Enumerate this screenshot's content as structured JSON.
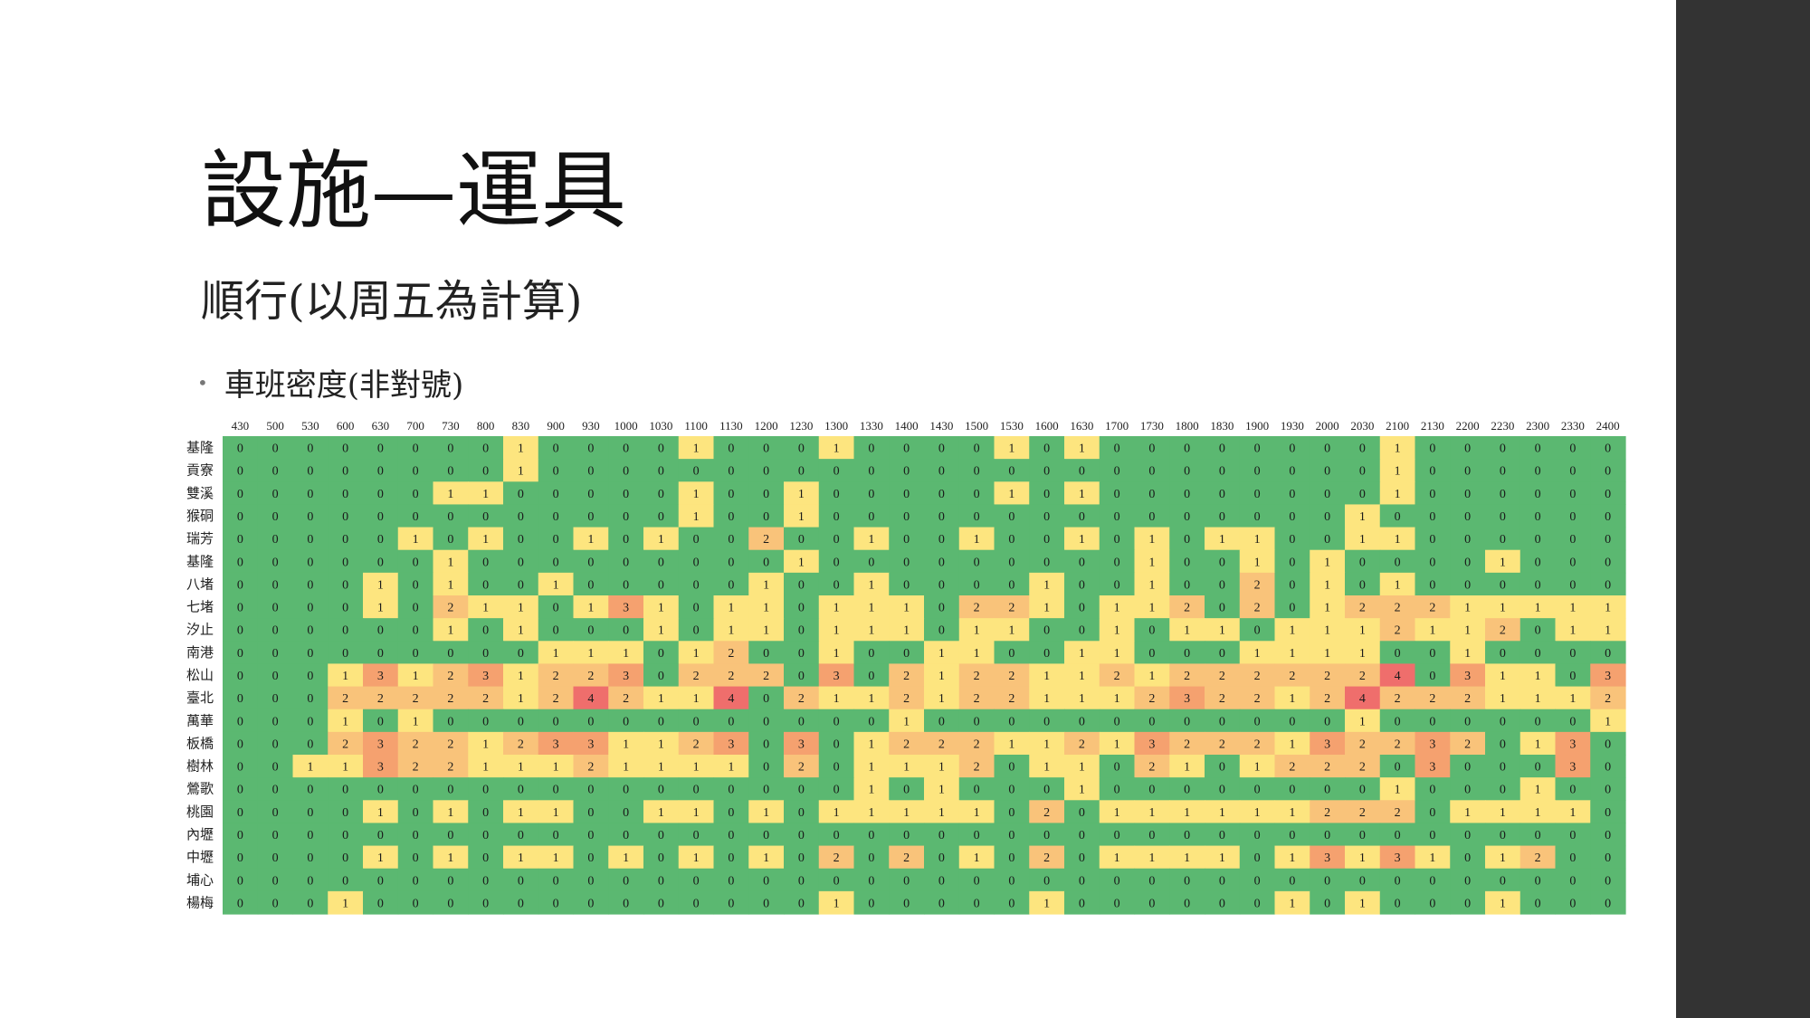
{
  "slide": {
    "title": "設施—運具",
    "subtitle": "順行(以周五為計算)",
    "bullet": "車班密度(非對號)"
  },
  "colors": {
    "sidebar": "#333333",
    "scale": [
      "#5bb871",
      "#fde57f",
      "#f9c37a",
      "#f5a16f",
      "#ef6e6c"
    ]
  },
  "chart_data": {
    "type": "heatmap",
    "x": [
      "430",
      "500",
      "530",
      "600",
      "630",
      "700",
      "730",
      "800",
      "830",
      "900",
      "930",
      "1000",
      "1030",
      "1100",
      "1130",
      "1200",
      "1230",
      "1300",
      "1330",
      "1400",
      "1430",
      "1500",
      "1530",
      "1600",
      "1630",
      "1700",
      "1730",
      "1800",
      "1830",
      "1900",
      "1930",
      "2000",
      "2030",
      "2100",
      "2130",
      "2200",
      "2230",
      "2300",
      "2330",
      "2400"
    ],
    "y": [
      "基隆",
      "貢寮",
      "雙溪",
      "猴硐",
      "瑞芳",
      "基隆",
      "八堵",
      "七堵",
      "汐止",
      "南港",
      "松山",
      "臺北",
      "萬華",
      "板橋",
      "樹林",
      "鶯歌",
      "桃園",
      "內壢",
      "中壢",
      "埔心",
      "楊梅"
    ],
    "values": [
      [
        0,
        0,
        0,
        0,
        0,
        0,
        0,
        0,
        1,
        0,
        0,
        0,
        0,
        1,
        0,
        0,
        0,
        1,
        0,
        0,
        0,
        0,
        1,
        0,
        1,
        0,
        0,
        0,
        0,
        0,
        0,
        0,
        0,
        1,
        0,
        0,
        0,
        0,
        0,
        0
      ],
      [
        0,
        0,
        0,
        0,
        0,
        0,
        0,
        0,
        1,
        0,
        0,
        0,
        0,
        0,
        0,
        0,
        0,
        0,
        0,
        0,
        0,
        0,
        0,
        0,
        0,
        0,
        0,
        0,
        0,
        0,
        0,
        0,
        0,
        1,
        0,
        0,
        0,
        0,
        0,
        0
      ],
      [
        0,
        0,
        0,
        0,
        0,
        0,
        1,
        1,
        0,
        0,
        0,
        0,
        0,
        1,
        0,
        0,
        1,
        0,
        0,
        0,
        0,
        0,
        1,
        0,
        1,
        0,
        0,
        0,
        0,
        0,
        0,
        0,
        0,
        1,
        0,
        0,
        0,
        0,
        0,
        0
      ],
      [
        0,
        0,
        0,
        0,
        0,
        0,
        0,
        0,
        0,
        0,
        0,
        0,
        0,
        1,
        0,
        0,
        1,
        0,
        0,
        0,
        0,
        0,
        0,
        0,
        0,
        0,
        0,
        0,
        0,
        0,
        0,
        0,
        1,
        0,
        0,
        0,
        0,
        0,
        0,
        0
      ],
      [
        0,
        0,
        0,
        0,
        0,
        1,
        0,
        1,
        0,
        0,
        1,
        0,
        1,
        0,
        0,
        2,
        0,
        0,
        1,
        0,
        0,
        1,
        0,
        0,
        1,
        0,
        1,
        0,
        1,
        1,
        0,
        0,
        1,
        1,
        0,
        0,
        0,
        0,
        0,
        0
      ],
      [
        0,
        0,
        0,
        0,
        0,
        0,
        1,
        0,
        0,
        0,
        0,
        0,
        0,
        0,
        0,
        0,
        1,
        0,
        0,
        0,
        0,
        0,
        0,
        0,
        0,
        0,
        1,
        0,
        0,
        1,
        0,
        1,
        0,
        0,
        0,
        0,
        1,
        0,
        0,
        0
      ],
      [
        0,
        0,
        0,
        0,
        1,
        0,
        1,
        0,
        0,
        1,
        0,
        0,
        0,
        0,
        0,
        1,
        0,
        0,
        1,
        0,
        0,
        0,
        0,
        1,
        0,
        0,
        1,
        0,
        0,
        2,
        0,
        1,
        0,
        1,
        0,
        0,
        0,
        0,
        0,
        0
      ],
      [
        0,
        0,
        0,
        0,
        1,
        0,
        2,
        1,
        1,
        0,
        1,
        3,
        1,
        0,
        1,
        1,
        0,
        1,
        1,
        1,
        0,
        2,
        2,
        1,
        0,
        1,
        1,
        2,
        0,
        2,
        0,
        1,
        2,
        2,
        2,
        1,
        1,
        1,
        1,
        1
      ],
      [
        0,
        0,
        0,
        0,
        0,
        0,
        1,
        0,
        1,
        0,
        0,
        0,
        1,
        0,
        1,
        1,
        0,
        1,
        1,
        1,
        0,
        1,
        1,
        0,
        0,
        1,
        0,
        1,
        1,
        0,
        1,
        1,
        1,
        2,
        1,
        1,
        2,
        0,
        1,
        1
      ],
      [
        0,
        0,
        0,
        0,
        0,
        0,
        0,
        0,
        0,
        1,
        1,
        1,
        0,
        1,
        2,
        0,
        0,
        1,
        0,
        0,
        1,
        1,
        0,
        0,
        1,
        1,
        0,
        0,
        0,
        1,
        1,
        1,
        1,
        0,
        0,
        1,
        0,
        0,
        0,
        0
      ],
      [
        0,
        0,
        0,
        1,
        3,
        1,
        2,
        3,
        1,
        2,
        2,
        3,
        0,
        2,
        2,
        2,
        0,
        3,
        0,
        2,
        1,
        2,
        2,
        1,
        1,
        2,
        1,
        2,
        2,
        2,
        2,
        2,
        2,
        4,
        0,
        3,
        1,
        1,
        0,
        3
      ],
      [
        0,
        0,
        0,
        2,
        2,
        2,
        2,
        2,
        1,
        2,
        4,
        2,
        1,
        1,
        4,
        0,
        2,
        1,
        1,
        2,
        1,
        2,
        2,
        1,
        1,
        1,
        2,
        3,
        2,
        2,
        1,
        2,
        4,
        2,
        2,
        2,
        1,
        1,
        1,
        2
      ],
      [
        0,
        0,
        0,
        1,
        0,
        1,
        0,
        0,
        0,
        0,
        0,
        0,
        0,
        0,
        0,
        0,
        0,
        0,
        0,
        1,
        0,
        0,
        0,
        0,
        0,
        0,
        0,
        0,
        0,
        0,
        0,
        0,
        1,
        0,
        0,
        0,
        0,
        0,
        0,
        1
      ],
      [
        0,
        0,
        0,
        2,
        3,
        2,
        2,
        1,
        2,
        3,
        3,
        1,
        1,
        2,
        3,
        0,
        3,
        0,
        1,
        2,
        2,
        2,
        1,
        1,
        2,
        1,
        3,
        2,
        2,
        2,
        1,
        3,
        2,
        2,
        3,
        2,
        0,
        1,
        3,
        0
      ],
      [
        0,
        0,
        1,
        1,
        3,
        2,
        2,
        1,
        1,
        1,
        2,
        1,
        1,
        1,
        1,
        0,
        2,
        0,
        1,
        1,
        1,
        2,
        0,
        1,
        1,
        0,
        2,
        1,
        0,
        1,
        2,
        2,
        2,
        0,
        3,
        0,
        0,
        0,
        3,
        0
      ],
      [
        0,
        0,
        0,
        0,
        0,
        0,
        0,
        0,
        0,
        0,
        0,
        0,
        0,
        0,
        0,
        0,
        0,
        0,
        1,
        0,
        1,
        0,
        0,
        0,
        1,
        0,
        0,
        0,
        0,
        0,
        0,
        0,
        0,
        1,
        0,
        0,
        0,
        1,
        0,
        0
      ],
      [
        0,
        0,
        0,
        0,
        1,
        0,
        1,
        0,
        1,
        1,
        0,
        0,
        1,
        1,
        0,
        1,
        0,
        1,
        1,
        1,
        1,
        1,
        0,
        2,
        0,
        1,
        1,
        1,
        1,
        1,
        1,
        2,
        2,
        2,
        0,
        1,
        1,
        1,
        1,
        0
      ],
      [
        0,
        0,
        0,
        0,
        0,
        0,
        0,
        0,
        0,
        0,
        0,
        0,
        0,
        0,
        0,
        0,
        0,
        0,
        0,
        0,
        0,
        0,
        0,
        0,
        0,
        0,
        0,
        0,
        0,
        0,
        0,
        0,
        0,
        0,
        0,
        0,
        0,
        0,
        0,
        0
      ],
      [
        0,
        0,
        0,
        0,
        1,
        0,
        1,
        0,
        1,
        1,
        0,
        1,
        0,
        1,
        0,
        1,
        0,
        2,
        0,
        2,
        0,
        1,
        0,
        2,
        0,
        1,
        1,
        1,
        1,
        0,
        1,
        3,
        1,
        3,
        1,
        0,
        1,
        2,
        0,
        0
      ],
      [
        0,
        0,
        0,
        0,
        0,
        0,
        0,
        0,
        0,
        0,
        0,
        0,
        0,
        0,
        0,
        0,
        0,
        0,
        0,
        0,
        0,
        0,
        0,
        0,
        0,
        0,
        0,
        0,
        0,
        0,
        0,
        0,
        0,
        0,
        0,
        0,
        0,
        0,
        0,
        0
      ],
      [
        0,
        0,
        0,
        1,
        0,
        0,
        0,
        0,
        0,
        0,
        0,
        0,
        0,
        0,
        0,
        0,
        0,
        1,
        0,
        0,
        0,
        0,
        0,
        1,
        0,
        0,
        0,
        0,
        0,
        0,
        1,
        0,
        1,
        0,
        0,
        0,
        1,
        0,
        0,
        0
      ]
    ]
  }
}
